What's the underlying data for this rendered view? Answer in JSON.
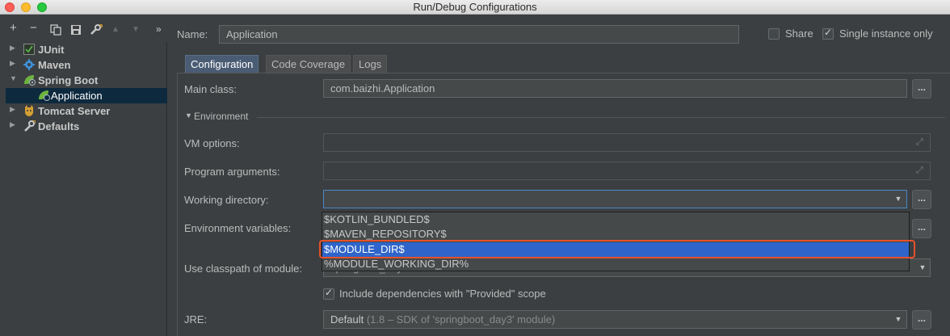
{
  "window": {
    "title": "Run/Debug Configurations"
  },
  "toolbar": {
    "icons": [
      "add-icon",
      "remove-icon",
      "copy-icon",
      "save-icon",
      "wrench-icon",
      "move-up-icon",
      "move-down-icon",
      "expand-more-icon"
    ]
  },
  "tree": {
    "items": [
      {
        "label": "JUnit",
        "expanded": false,
        "icon": "junit-icon"
      },
      {
        "label": "Maven",
        "expanded": false,
        "icon": "maven-icon"
      },
      {
        "label": "Spring Boot",
        "expanded": true,
        "icon": "spring-boot-icon"
      },
      {
        "label": "Application",
        "selected": true,
        "icon": "spring-app-icon"
      },
      {
        "label": "Tomcat Server",
        "expanded": false,
        "icon": "tomcat-icon"
      },
      {
        "label": "Defaults",
        "expanded": false,
        "icon": "defaults-icon"
      }
    ]
  },
  "header": {
    "name_label": "Name:",
    "name_value": "Application",
    "share_label": "Share",
    "share_checked": false,
    "single_instance_label": "Single instance only",
    "single_instance_checked": true
  },
  "tabs": [
    {
      "label": "Configuration",
      "active": true
    },
    {
      "label": "Code Coverage",
      "active": false
    },
    {
      "label": "Logs",
      "active": false
    }
  ],
  "form": {
    "main_class_label": "Main class:",
    "main_class_value": "com.baizhi.Application",
    "environment_label": "Environment",
    "vm_options_label": "VM options:",
    "vm_options_value": "",
    "program_args_label": "Program arguments:",
    "program_args_value": "",
    "working_dir_label": "Working directory:",
    "working_dir_value": "",
    "env_vars_label": "Environment variables:",
    "classpath_label": "Use classpath of module:",
    "classpath_value_partial": "springboot_day3",
    "include_deps_label": "Include dependencies with \"Provided\" scope",
    "include_deps_checked": true,
    "jre_label": "JRE:",
    "jre_value": "Default",
    "jre_detail": "(1.8 – SDK of 'springboot_day3' module)",
    "dots_label": "...",
    "bottom_row_partial": ""
  },
  "dropdown": {
    "options": [
      "$KOTLIN_BUNDLED$",
      "$MAVEN_REPOSITORY$",
      "$MODULE_DIR$",
      "%MODULE_WORKING_DIR%"
    ],
    "selected_index": 2
  },
  "colors": {
    "background": "#3c3f41",
    "selection": "#2f65ca",
    "highlight": "#e8502a",
    "active_tab": "#4a5c74"
  }
}
